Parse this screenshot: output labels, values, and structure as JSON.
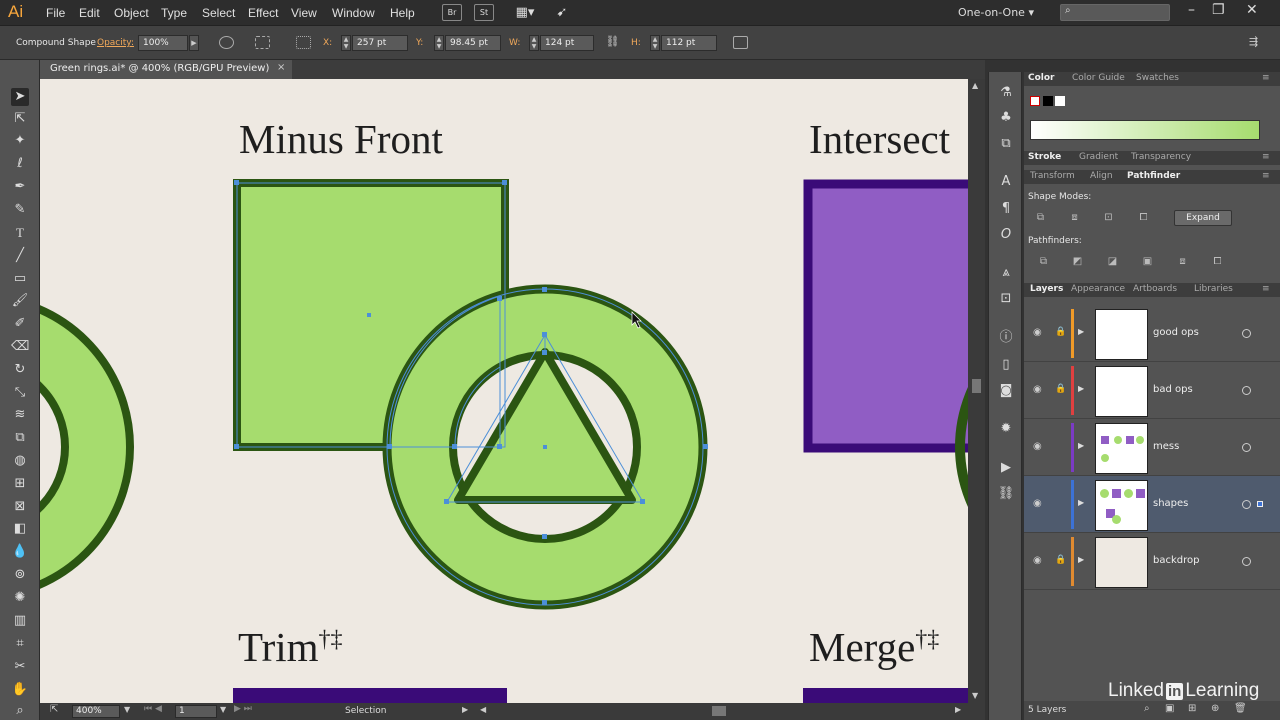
{
  "app": {
    "logo": "Ai"
  },
  "menu": [
    "File",
    "Edit",
    "Object",
    "Type",
    "Select",
    "Effect",
    "View",
    "Window",
    "Help"
  ],
  "toolbar_icons": {
    "br": "Br",
    "st": "St"
  },
  "workspace": "One-on-One",
  "control_bar": {
    "shape_type": "Compound Shape",
    "opacity_label": "Opacity:",
    "opacity_value": "100%",
    "x_label": "X:",
    "x_value": "257 pt",
    "y_label": "Y:",
    "y_value": "98.45 pt",
    "w_label": "W:",
    "w_value": "124 pt",
    "h_label": "H:",
    "h_value": "112 pt"
  },
  "document": {
    "tab_label": "Green rings.ai* @ 400% (RGB/GPU Preview)",
    "close": "×"
  },
  "canvas": {
    "labels": {
      "minus_front": "Minus Front",
      "intersect": "Intersect",
      "trim": "Trim",
      "trim_marks": "†‡",
      "merge": "Merge",
      "merge_marks": "†‡"
    },
    "colors": {
      "green_fill": "#a6dc6e",
      "green_stroke": "#2b5512",
      "purple_fill": "#905dc4",
      "purple_stroke": "#3a0b78",
      "selection": "#4c8fd8",
      "background": "#eee9e2"
    }
  },
  "status_bar": {
    "zoom": "400%",
    "artboard": "1",
    "tool": "Selection"
  },
  "panels": {
    "color_tabs": [
      "Color",
      "Color Guide",
      "Swatches"
    ],
    "stroke_tabs": [
      "Stroke",
      "Gradient",
      "Transparency"
    ],
    "transform_tabs": [
      "Transform",
      "Align",
      "Pathfinder"
    ],
    "shape_modes_label": "Shape Modes:",
    "expand_label": "Expand",
    "pathfinders_label": "Pathfinders:",
    "layers_tabs": [
      "Layers",
      "Appearance",
      "Artboards",
      "Libraries"
    ],
    "layers": [
      {
        "name": "good ops",
        "color": "#f09a28"
      },
      {
        "name": "bad ops",
        "color": "#e04040"
      },
      {
        "name": "mess",
        "color": "#7b3bc4"
      },
      {
        "name": "shapes",
        "color": "#3c72d6"
      },
      {
        "name": "backdrop",
        "color": "#e08a30"
      }
    ],
    "layers_count": "5 Layers"
  },
  "watermark": {
    "pre": "Linked",
    "box": "in",
    "post": "Learning"
  }
}
